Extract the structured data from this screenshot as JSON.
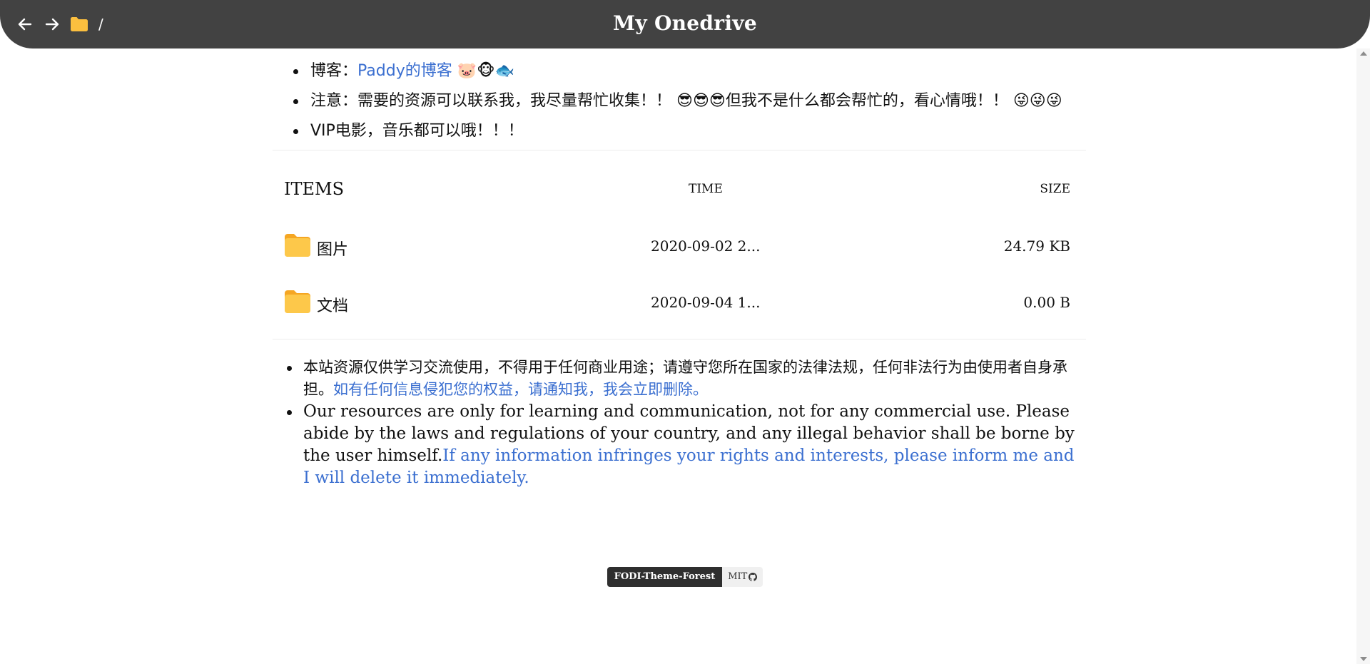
{
  "header": {
    "title": "My Onedrive",
    "breadcrumb": "/",
    "icons": {
      "back": "arrow-left-icon",
      "forward": "arrow-right-icon",
      "folder": "folder-icon"
    }
  },
  "notice_top": {
    "blog_label": "博客：",
    "blog_link": "Paddy的博客",
    "blog_emojis": "🐷🐵🐟",
    "note_text": "注意：需要的资源可以联系我，我尽量帮忙收集！！",
    "note_emojis_1": "😎😎😎",
    "note_text_2": "但我不是什么都会帮忙的，看心情哦！！",
    "note_emojis_2": "😜😜😜",
    "vip_text": "VIP电影，音乐都可以哦！！！"
  },
  "list": {
    "header_items": "ITEMS",
    "header_time": "TIME",
    "header_size": "SIZE",
    "rows": [
      {
        "name": "图片",
        "time": "2020-09-02 2...",
        "size": "24.79 KB"
      },
      {
        "name": "文档",
        "time": "2020-09-04 1...",
        "size": "0.00 B"
      }
    ]
  },
  "notice_bottom": {
    "zh_text": "本站资源仅供学习交流使用，不得用于任何商业用途；请遵守您所在国家的法律法规，任何非法行为由使用者自身承担。",
    "zh_link": "如有任何信息侵犯您的权益，请通知我，我会立即删除。",
    "en_text": "Our resources are only for learning and communication, not for any commercial use. Please abide by the laws and regulations of your country, and any illegal behavior shall be borne by the user himself.",
    "en_link": "If any information infringes your rights and interests, please inform me and I will delete it immediately."
  },
  "footer": {
    "badge_left": "FODI-Theme-Forest",
    "badge_right": "MIT"
  },
  "colors": {
    "header_bg": "#424242",
    "link": "#3b6fd0",
    "folder": "#fbbf3f"
  }
}
